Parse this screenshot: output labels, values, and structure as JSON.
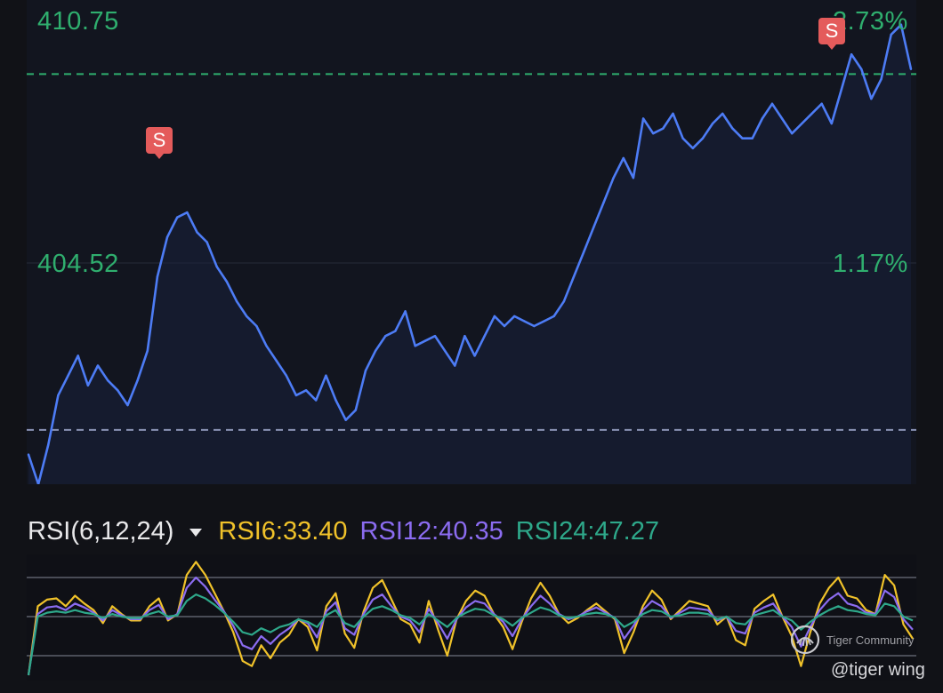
{
  "price_chart": {
    "labels": {
      "top_price": "410.75",
      "mid_price": "404.52",
      "top_pct": "2.73%",
      "mid_pct": "1.17%"
    },
    "signals": [
      "S",
      "S"
    ],
    "colors": {
      "line": "#4d7cf5",
      "axis_text": "#2fae6e",
      "ref_line": "#2fae6e",
      "base_line": "#8a93b5",
      "background": "#12151f"
    }
  },
  "rsi_panel": {
    "title": "RSI(6,12,24)",
    "rsi6": "RSI6:33.40",
    "rsi12": "RSI12:40.35",
    "rsi24": "RSI24:47.27",
    "colors": {
      "rsi6": "#f0c22a",
      "rsi12": "#8b6cf0",
      "rsi24": "#2ea88a"
    }
  },
  "watermark": {
    "text": "Tiger Community",
    "icon": "tiger-community-logo"
  },
  "user_tag": "@tiger wing",
  "chart_data": [
    {
      "type": "line",
      "title": "",
      "xlabel": "",
      "ylabel": "",
      "ylim": [
        401.8,
        411.6
      ],
      "reference_lines": [
        410.1,
        402.9
      ],
      "y_tick_labels": [
        "410.75",
        "404.52"
      ],
      "right_tick_labels": [
        "2.73%",
        "1.17%"
      ],
      "series": [
        {
          "values": [
            402.4,
            401.8,
            402.6,
            403.6,
            404.0,
            404.4,
            403.8,
            404.2,
            403.9,
            403.7,
            403.4,
            403.9,
            404.5,
            406.0,
            406.8,
            407.2,
            407.3,
            406.9,
            406.7,
            406.2,
            405.9,
            405.5,
            405.2,
            405.0,
            404.6,
            404.3,
            404.0,
            403.6,
            403.7,
            403.5,
            404.0,
            403.5,
            403.1,
            403.3,
            404.1,
            404.5,
            404.8,
            404.9,
            405.3,
            404.6,
            404.7,
            404.8,
            404.5,
            404.2,
            404.8,
            404.4,
            404.8,
            405.2,
            405.0,
            405.2,
            405.1,
            405.0,
            405.1,
            405.2,
            405.5,
            406.0,
            406.5,
            407.0,
            407.5,
            408.0,
            408.4,
            408.0,
            409.2,
            408.9,
            409.0,
            409.3,
            408.8,
            408.6,
            408.8,
            409.1,
            409.3,
            409.0,
            408.8,
            408.8,
            409.2,
            409.5,
            409.2,
            408.9,
            409.1,
            409.3,
            409.5,
            409.1,
            409.8,
            410.5,
            410.2,
            409.6,
            410.0,
            410.9,
            411.1,
            410.2
          ]
        }
      ],
      "signals": [
        {
          "x_index": 15,
          "label": "S"
        },
        {
          "x_index": 86,
          "label": "S"
        }
      ]
    },
    {
      "type": "line",
      "title": "RSI(6,12,24)",
      "ylim": [
        0,
        100
      ],
      "reference_lines": [
        80,
        50,
        20
      ],
      "series": [
        {
          "name": "RSI6",
          "last": 33.4,
          "values": [
            5,
            58,
            63,
            64,
            58,
            66,
            60,
            55,
            45,
            58,
            52,
            47,
            47,
            58,
            64,
            47,
            52,
            82,
            92,
            82,
            68,
            54,
            38,
            16,
            12,
            28,
            18,
            30,
            36,
            48,
            42,
            24,
            58,
            68,
            37,
            26,
            54,
            72,
            78,
            63,
            48,
            44,
            30,
            62,
            40,
            20,
            48,
            62,
            70,
            66,
            52,
            42,
            25,
            46,
            64,
            76,
            66,
            52,
            45,
            49,
            55,
            60,
            54,
            48,
            22,
            38,
            58,
            70,
            63,
            48,
            55,
            62,
            60,
            58,
            44,
            50,
            32,
            28,
            56,
            62,
            67,
            50,
            35,
            12,
            38,
            60,
            72,
            80,
            66,
            64,
            55,
            52,
            82,
            74,
            44,
            33
          ]
        },
        {
          "name": "RSI12",
          "last": 40.35,
          "values": [
            5,
            52,
            57,
            58,
            55,
            60,
            57,
            53,
            47,
            55,
            51,
            48,
            48,
            55,
            59,
            48,
            52,
            72,
            80,
            73,
            63,
            54,
            43,
            28,
            25,
            35,
            29,
            36,
            41,
            48,
            45,
            34,
            54,
            61,
            41,
            36,
            52,
            63,
            67,
            58,
            50,
            47,
            38,
            56,
            45,
            33,
            48,
            57,
            62,
            60,
            52,
            46,
            35,
            48,
            58,
            66,
            60,
            52,
            48,
            50,
            54,
            57,
            53,
            49,
            33,
            43,
            55,
            62,
            58,
            49,
            53,
            57,
            56,
            55,
            47,
            50,
            39,
            37,
            53,
            57,
            60,
            50,
            42,
            27,
            42,
            55,
            63,
            68,
            60,
            58,
            53,
            52,
            70,
            65,
            48,
            40
          ]
        },
        {
          "name": "RSI24",
          "last": 47.27,
          "values": [
            5,
            50,
            53,
            54,
            53,
            55,
            53,
            52,
            49,
            52,
            50,
            49,
            49,
            52,
            54,
            50,
            51,
            62,
            67,
            64,
            59,
            53,
            46,
            38,
            36,
            41,
            38,
            42,
            44,
            48,
            46,
            42,
            51,
            55,
            45,
            42,
            50,
            56,
            58,
            55,
            51,
            49,
            44,
            52,
            47,
            42,
            49,
            53,
            56,
            55,
            51,
            48,
            43,
            49,
            53,
            57,
            55,
            51,
            49,
            50,
            52,
            53,
            52,
            49,
            42,
            46,
            52,
            55,
            54,
            50,
            51,
            53,
            53,
            52,
            48,
            50,
            45,
            44,
            51,
            53,
            55,
            50,
            47,
            40,
            46,
            51,
            55,
            58,
            55,
            54,
            52,
            51,
            60,
            58,
            50,
            47
          ]
        }
      ]
    }
  ]
}
